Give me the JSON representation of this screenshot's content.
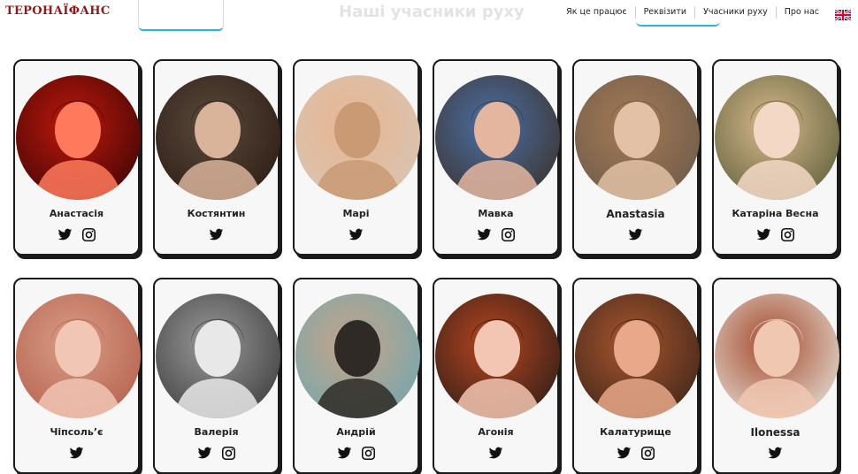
{
  "brand": {
    "logo_text": "ТЕРОНАЇФАНС"
  },
  "header": {
    "faded_title": "Наші учасники руху"
  },
  "nav": {
    "items": [
      "Як це працює",
      "Реквізити",
      "Учасники руху",
      "Про нас"
    ],
    "language_icon": "uk-flag-icon"
  },
  "members": [
    {
      "name": "Анастасія",
      "twitter": true,
      "instagram": true,
      "palette": [
        "#3a0505",
        "#c0180c",
        "#ff7a5c"
      ]
    },
    {
      "name": "Костянтин",
      "twitter": true,
      "instagram": false,
      "palette": [
        "#2a1a12",
        "#5b4a3c",
        "#d9b39a"
      ]
    },
    {
      "name": "Марі",
      "twitter": true,
      "instagram": false,
      "palette": [
        "#d8c6b6",
        "#e7b48f",
        "#c99a74"
      ]
    },
    {
      "name": "Мавка",
      "twitter": true,
      "instagram": true,
      "palette": [
        "#3b3128",
        "#4b6fa6",
        "#e4b6a0"
      ]
    },
    {
      "name": "Anastasia",
      "twitter": true,
      "instagram": false,
      "palette": [
        "#6b5a4a",
        "#a57a55",
        "#e2c1a6"
      ]
    },
    {
      "name": "Катаріна Весна",
      "twitter": true,
      "instagram": true,
      "palette": [
        "#5b5d3a",
        "#d8b98c",
        "#f3d8c5"
      ]
    },
    {
      "name": "Чіпсоль’є",
      "twitter": true,
      "instagram": false,
      "palette": [
        "#b35f4c",
        "#d99d86",
        "#f1c6b5"
      ]
    },
    {
      "name": "Валерія",
      "twitter": true,
      "instagram": true,
      "palette": [
        "#3a3a3a",
        "#9a9a9a",
        "#e8e8e8"
      ]
    },
    {
      "name": "Андрій",
      "twitter": true,
      "instagram": true,
      "palette": [
        "#6fa7b0",
        "#c8a488",
        "#2f2a26"
      ]
    },
    {
      "name": "Агонія",
      "twitter": true,
      "instagram": false,
      "palette": [
        "#2a1d18",
        "#b8451f",
        "#f2c6b2"
      ]
    },
    {
      "name": "Калатурище",
      "twitter": true,
      "instagram": true,
      "palette": [
        "#3b2418",
        "#a8552f",
        "#e8a889"
      ]
    },
    {
      "name": "Ilonessa",
      "twitter": true,
      "instagram": false,
      "palette": [
        "#e8e4dc",
        "#a44a2c",
        "#f0c7b1"
      ]
    }
  ],
  "icons": {
    "twitter": "twitter-icon",
    "instagram": "instagram-icon"
  }
}
